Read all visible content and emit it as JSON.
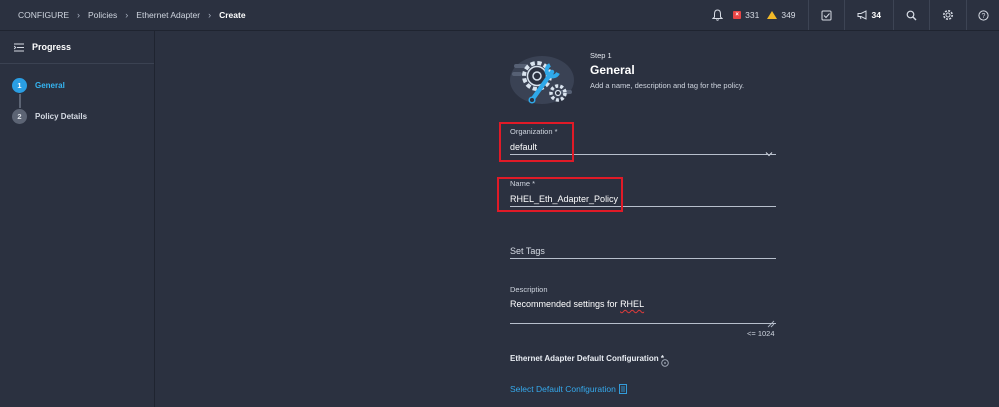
{
  "breadcrumb": {
    "items": [
      "CONFIGURE",
      "Policies",
      "Ethernet Adapter"
    ],
    "current": "Create"
  },
  "topbar": {
    "errors_count": "331",
    "warnings_count": "349",
    "announcements_count": "34",
    "icons": [
      "bell-icon",
      "error-icon",
      "warning-icon",
      "tasks-icon",
      "megaphone-icon",
      "search-icon",
      "gear-icon",
      "help-icon"
    ]
  },
  "progress": {
    "title": "Progress",
    "steps": [
      {
        "number": "1",
        "label": "General",
        "active": true
      },
      {
        "number": "2",
        "label": "Policy Details",
        "active": false
      }
    ]
  },
  "step_header": {
    "step": "Step 1",
    "title": "General",
    "description": "Add a name, description and tag for the policy."
  },
  "form": {
    "organization": {
      "label": "Organization *",
      "value": "default"
    },
    "name": {
      "label": "Name *",
      "value": "RHEL_Eth_Adapter_Policy"
    },
    "tags": {
      "placeholder": "Set Tags"
    },
    "description": {
      "label": "Description",
      "value_prefix": "Recommended settings for ",
      "value_flagged": "RHEL",
      "counter": "<= 1024"
    },
    "default_config": {
      "label": "Ethernet Adapter Default Configuration *",
      "link": "Select Default Configuration"
    }
  },
  "colors": {
    "background": "#2b3140",
    "accent": "#2a9ee3",
    "link": "#35a9ec",
    "highlight": "#e01a27",
    "error": "#e84545",
    "warning": "#f2b928"
  }
}
